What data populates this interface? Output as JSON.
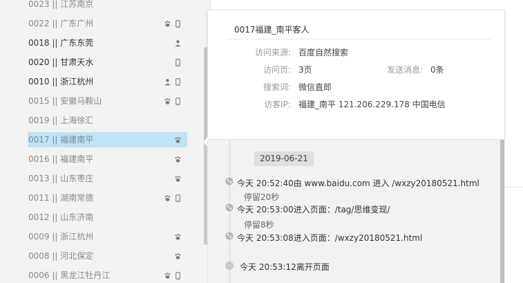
{
  "visitor_list": [
    {
      "label": "0023 || 江苏南京",
      "style": "muted",
      "icons": []
    },
    {
      "label": "0022 || 广东广州",
      "style": "muted",
      "icons": [
        "paw-icon",
        "phone-icon"
      ]
    },
    {
      "label": "0018 || 广东东莞",
      "style": "dark",
      "icons": [
        "person-icon"
      ]
    },
    {
      "label": "0020 || 甘肃天水",
      "style": "dark",
      "icons": [
        "phone-icon"
      ]
    },
    {
      "label": "0010 || 浙江杭州",
      "style": "dark",
      "icons": [
        "person-icon",
        "phone-icon"
      ]
    },
    {
      "label": "0015 || 安徽马鞍山",
      "style": "muted",
      "icons": [
        "paw-icon",
        "phone-icon"
      ]
    },
    {
      "label": "0019 || 上海徐汇",
      "style": "muted",
      "icons": []
    },
    {
      "label": "0017 || 福建南平",
      "style": "selected",
      "icons": [
        "paw-icon"
      ]
    },
    {
      "label": "0016 || 福建南平",
      "style": "muted",
      "icons": [
        "paw-icon"
      ]
    },
    {
      "label": "0013 || 山东枣庄",
      "style": "muted",
      "icons": [
        "paw-icon"
      ]
    },
    {
      "label": "0011 || 湖南常德",
      "style": "muted",
      "icons": [
        "paw-icon",
        "phone-icon"
      ]
    },
    {
      "label": "0012 || 山东济南",
      "style": "muted",
      "icons": []
    },
    {
      "label": "0009 || 浙江杭州",
      "style": "muted",
      "icons": [
        "paw-icon"
      ]
    },
    {
      "label": "0008 || 河北保定",
      "style": "muted",
      "icons": [
        "paw-icon"
      ]
    },
    {
      "label": "0006 || 黑龙江牡丹江",
      "style": "muted",
      "icons": [
        "paw-icon",
        "phone-icon"
      ]
    }
  ],
  "detail": {
    "title": "0017福建_南平客人",
    "source_label": "访问来源:",
    "source_value": "百度自然搜索",
    "pages_label": "访问页:",
    "pages_value": "3页",
    "messages_label": "发送消息:",
    "messages_value": "0条",
    "keyword_label": "搜索词:",
    "keyword_value": "微信直郎",
    "ip_label": "访客IP:",
    "ip_value": "福建_南平 121.206.229.178 中国电信"
  },
  "timeline": {
    "date": "2019-06-21",
    "events": [
      {
        "text": "今天 20:52:40由 www.baidu.com 进入 /wxzy20180521.html",
        "stay": "停留20秒"
      },
      {
        "text": "今天 20:53:00进入页面：/tag/思维变现/",
        "stay": "停留8秒"
      },
      {
        "text": "今天 20:53:08进入页面：/wxzy20180521.html",
        "stay": ""
      }
    ],
    "end_text": "今天 20:53:12离开页面"
  }
}
